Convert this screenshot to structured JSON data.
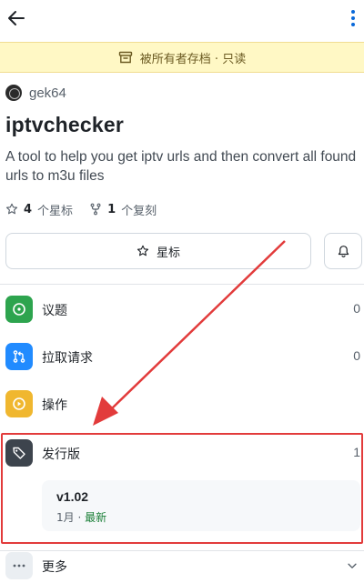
{
  "header": {
    "back_icon": "arrow-left-icon",
    "menu_icon": "kebab-vertical-icon"
  },
  "banner": {
    "icon": "archive-icon",
    "text": "被所有者存档 · 只读",
    "bg_color": "#fff8c5"
  },
  "repo": {
    "owner": "gek64",
    "name": "iptvchecker",
    "description": "A tool to help you get iptv urls and then convert all found urls to m3u files",
    "stars_count": "4",
    "stars_label": "个星标",
    "forks_count": "1",
    "forks_label": "个复刻"
  },
  "actions": {
    "star_label": "星标",
    "star_icon": "star-icon",
    "bell_icon": "bell-icon"
  },
  "sections": [
    {
      "label": "议题",
      "count": "0",
      "icon": "issue-opened-icon",
      "color": "#2da44e"
    },
    {
      "label": "拉取请求",
      "count": "0",
      "icon": "git-pull-request-icon",
      "color": "#218bff"
    },
    {
      "label": "操作",
      "count": "",
      "icon": "play-icon",
      "color": "#f0b72f"
    },
    {
      "label": "发行版",
      "count": "1",
      "icon": "tag-icon",
      "color": "#3d444d"
    },
    {
      "label": "更多",
      "count": "",
      "icon": "kebab-horizontal-icon",
      "color": "#eaeef2"
    }
  ],
  "release": {
    "version": "v1.02",
    "month": "1月",
    "separator": " · ",
    "latest": "最新"
  },
  "annotation": {
    "highlight_color": "#e23b3b"
  }
}
